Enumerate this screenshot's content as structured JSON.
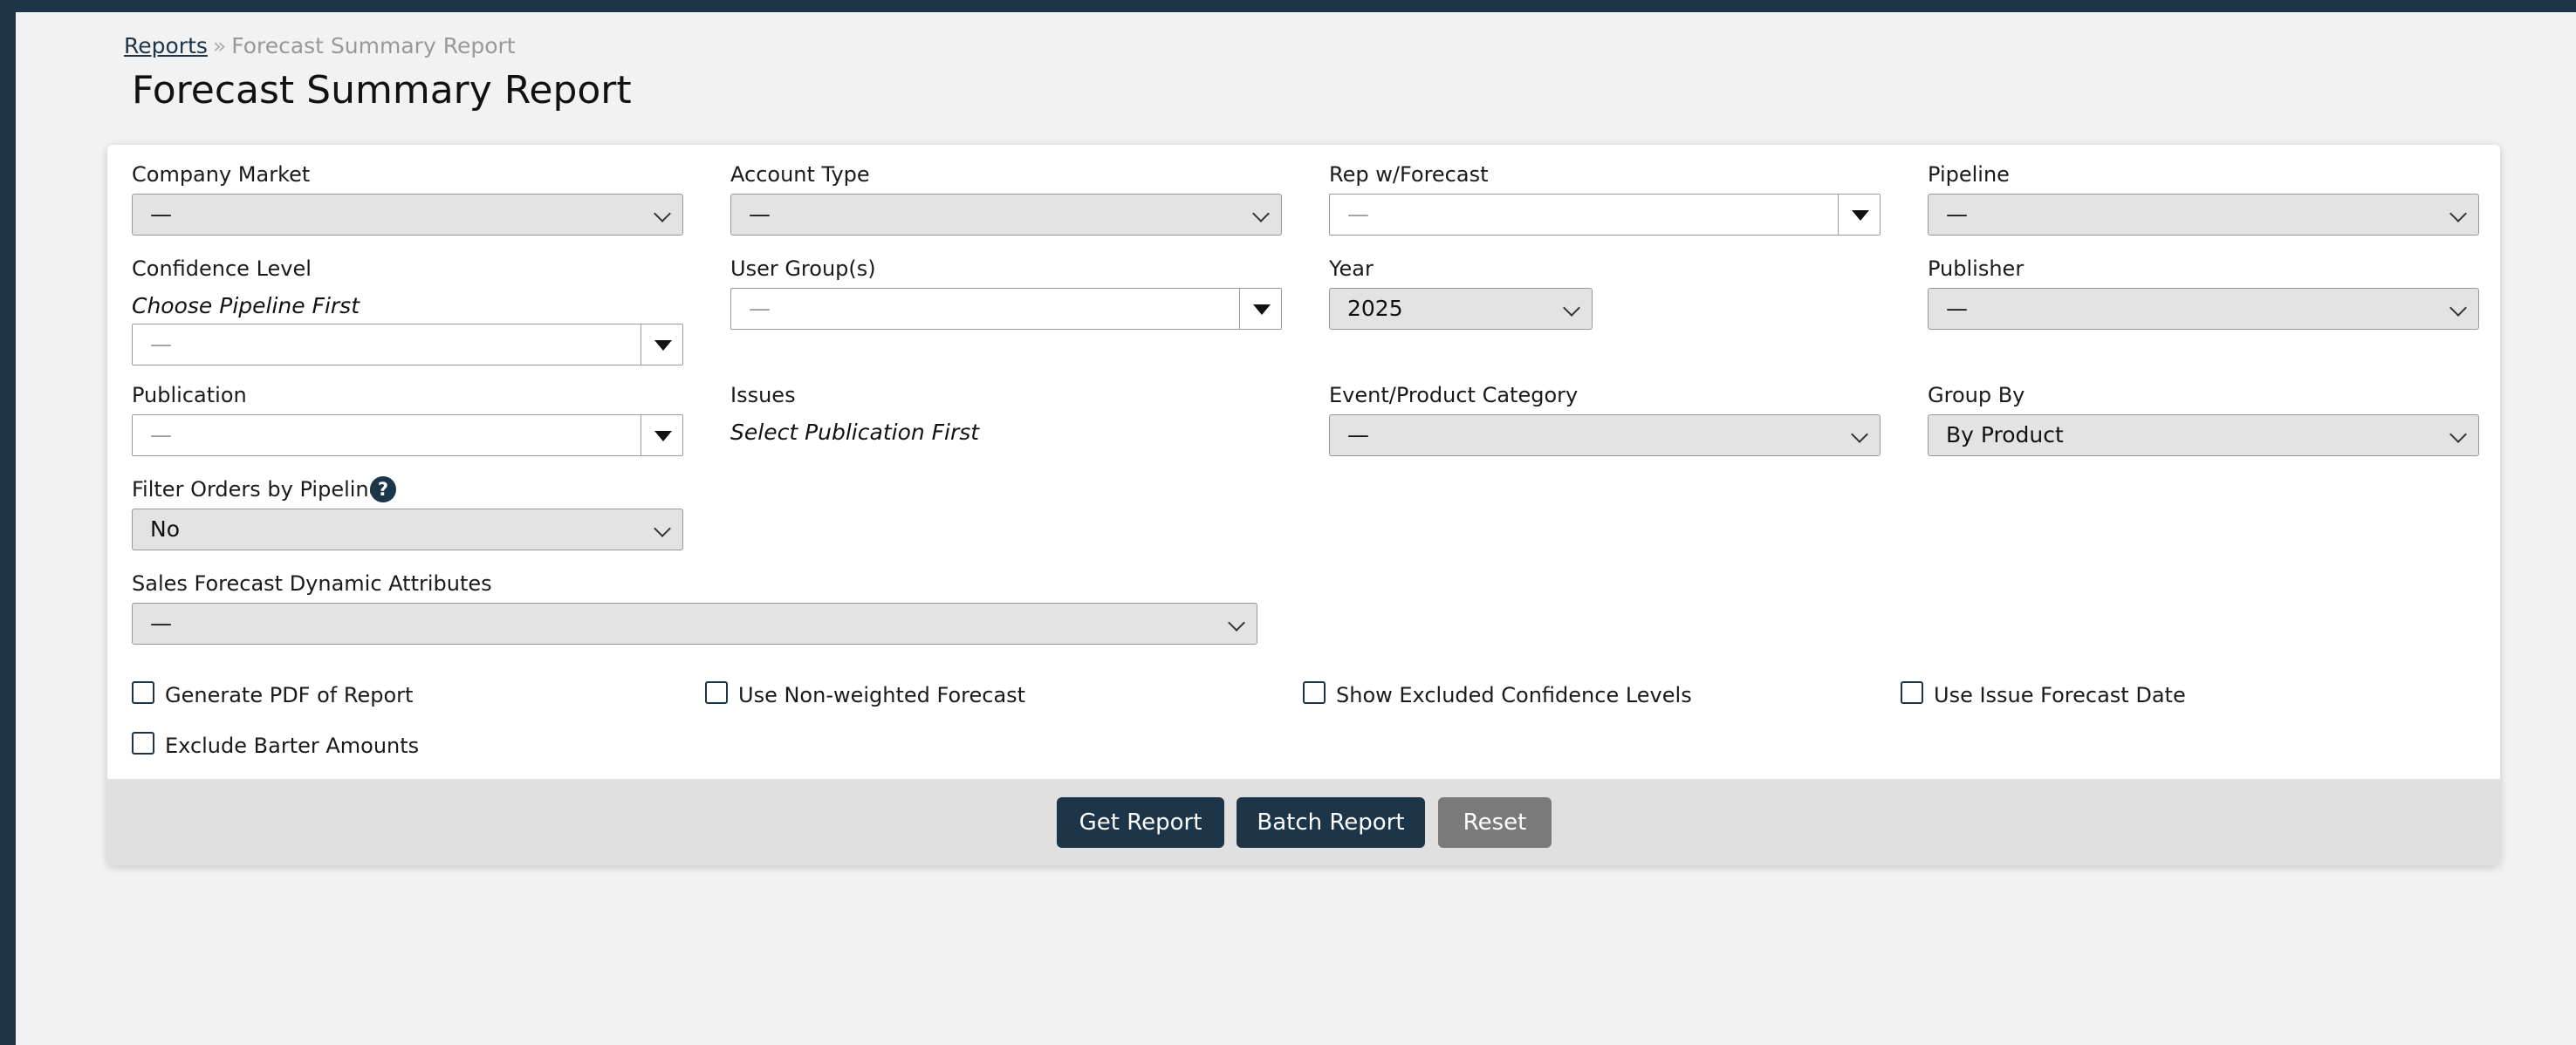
{
  "breadcrumb": {
    "root": "Reports",
    "separator": "»",
    "current": "Forecast Summary Report"
  },
  "page_title": "Forecast Summary Report",
  "fields": {
    "company_market": {
      "label": "Company Market",
      "value": "—"
    },
    "account_type": {
      "label": "Account Type",
      "value": "—"
    },
    "rep_forecast": {
      "label": "Rep w/Forecast",
      "placeholder": "—"
    },
    "pipeline": {
      "label": "Pipeline",
      "value": "—"
    },
    "confidence_level": {
      "label": "Confidence Level",
      "note": "Choose Pipeline First",
      "placeholder": "—"
    },
    "user_groups": {
      "label": "User Group(s)",
      "placeholder": "—"
    },
    "year": {
      "label": "Year",
      "value": "2025"
    },
    "publisher": {
      "label": "Publisher",
      "value": "—"
    },
    "publication": {
      "label": "Publication",
      "placeholder": "—"
    },
    "issues": {
      "label": "Issues",
      "note": "Select Publication First"
    },
    "event_product_category": {
      "label": "Event/Product Category",
      "value": "—"
    },
    "group_by": {
      "label": "Group By",
      "value": "By Product"
    },
    "filter_orders": {
      "label": "Filter Orders by Pipeline",
      "value": "No",
      "help": "?"
    },
    "dynamic_attributes": {
      "label": "Sales Forecast Dynamic Attributes",
      "value": "—"
    }
  },
  "checkboxes": {
    "generate_pdf": "Generate PDF of Report",
    "non_weighted": "Use Non-weighted Forecast",
    "show_excluded": "Show Excluded Confidence Levels",
    "issue_forecast_date": "Use Issue Forecast Date",
    "exclude_barter": "Exclude Barter Amounts"
  },
  "buttons": {
    "get_report": "Get Report",
    "batch_report": "Batch Report",
    "reset": "Reset"
  },
  "colors": {
    "primary": "#1c3548",
    "reset": "#7a7a7a",
    "footer": "#e0e0e0",
    "select_bg": "#e3e3e3"
  }
}
